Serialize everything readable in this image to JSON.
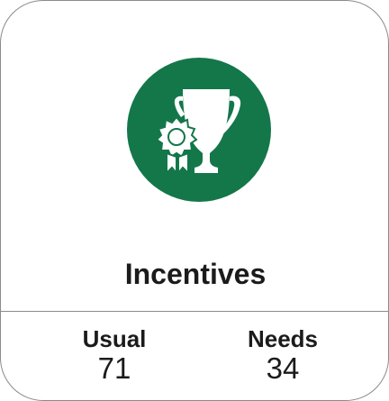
{
  "card": {
    "icon": "trophy-award-icon",
    "accent_color": "#13774a",
    "title": "Incentives",
    "stats": [
      {
        "label": "Usual",
        "value": "71"
      },
      {
        "label": "Needs",
        "value": "34"
      }
    ]
  }
}
